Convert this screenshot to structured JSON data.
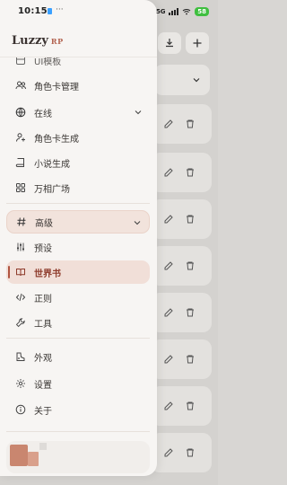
{
  "status_bar": {
    "time": "10:15",
    "more": "···",
    "signal_text": "5G",
    "battery": "58"
  },
  "brand": {
    "name": "Luzzy",
    "suffix": "RP"
  },
  "nav": {
    "items": [
      {
        "label": "UI模板",
        "icon": "layout-icon"
      },
      {
        "label": "角色卡管理",
        "icon": "users-icon"
      },
      {
        "label": "在线",
        "icon": "globe-icon",
        "expandable": true
      },
      {
        "label": "角色卡生成",
        "icon": "user-plus-icon"
      },
      {
        "label": "小说生成",
        "icon": "book-icon"
      },
      {
        "label": "万相广场",
        "icon": "grid-icon"
      },
      {
        "label": "高级",
        "icon": "hash-icon",
        "expandable": true,
        "expanded": true
      },
      {
        "label": "预设",
        "icon": "sliders-icon"
      },
      {
        "label": "世界书",
        "icon": "book-open-icon",
        "selected": true
      },
      {
        "label": "正则",
        "icon": "code-icon"
      },
      {
        "label": "工具",
        "icon": "wrench-icon"
      },
      {
        "label": "外观",
        "icon": "palette-icon"
      },
      {
        "label": "设置",
        "icon": "gear-icon"
      },
      {
        "label": "关于",
        "icon": "info-icon"
      }
    ]
  },
  "colors": {
    "accent": "#b0533f",
    "drawer_bg": "#f7f5f3",
    "active_bg": "#f1dfd8"
  }
}
